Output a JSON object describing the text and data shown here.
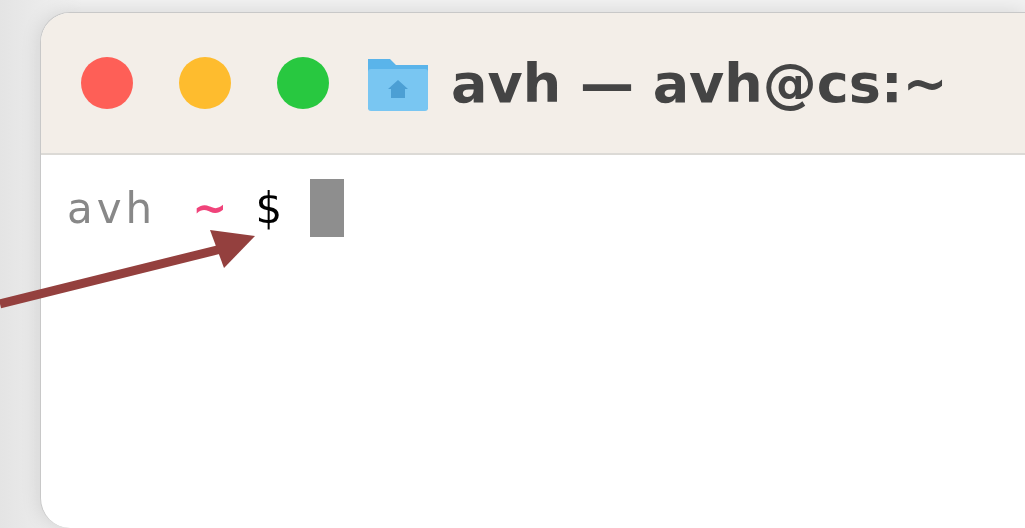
{
  "window": {
    "title": "avh — avh@cs:~",
    "buttons": [
      {
        "color": "#fe5f57"
      },
      {
        "color": "#febc2e"
      },
      {
        "color": "#28c840"
      }
    ]
  },
  "terminal": {
    "prompt": {
      "user": "avh",
      "directory": "~",
      "symbol": "$"
    }
  },
  "annotation": {
    "kind": "arrow"
  }
}
